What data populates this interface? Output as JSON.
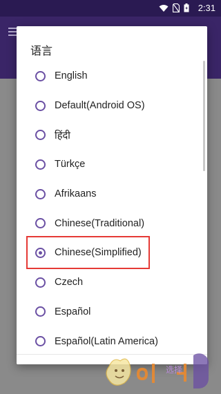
{
  "status_bar": {
    "time": "2:31",
    "icons": [
      "wifi-icon",
      "no-sim-icon",
      "battery-icon"
    ]
  },
  "dialog": {
    "title": "语言",
    "options": [
      {
        "label": "English",
        "selected": false
      },
      {
        "label": "Default(Android OS)",
        "selected": false
      },
      {
        "label": "हिंदी",
        "selected": false
      },
      {
        "label": "Türkçe",
        "selected": false
      },
      {
        "label": "Afrikaans",
        "selected": false
      },
      {
        "label": "Chinese(Traditional)",
        "selected": false
      },
      {
        "label": "Chinese(Simplified)",
        "selected": true
      },
      {
        "label": "Czech",
        "selected": false
      },
      {
        "label": "Español",
        "selected": false
      },
      {
        "label": "Español(Latin America)",
        "selected": false
      }
    ],
    "confirm_label": "选择"
  },
  "colors": {
    "accent": "#6a4fa3",
    "appbar": "#3a2567",
    "highlight": "#e53935"
  }
}
